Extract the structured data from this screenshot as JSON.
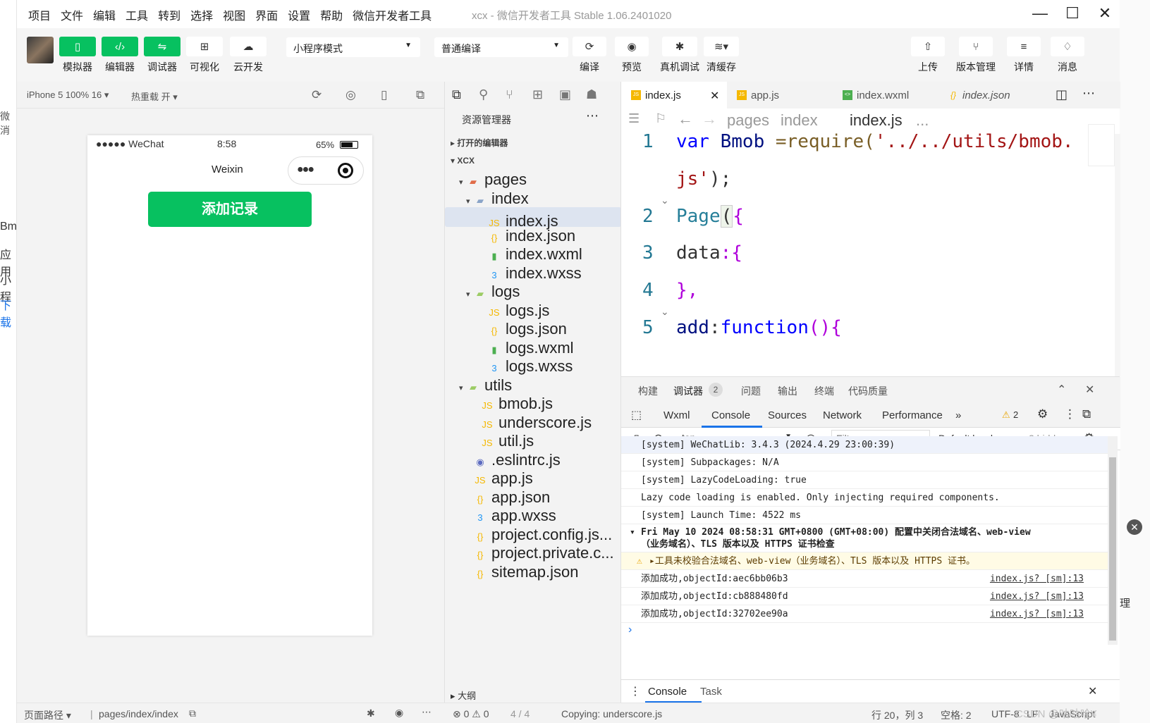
{
  "menu": [
    "项目",
    "文件",
    "编辑",
    "工具",
    "转到",
    "选择",
    "视图",
    "界面",
    "设置",
    "帮助",
    "微信开发者工具"
  ],
  "window_title": "xcx - 微信开发者工具 Stable 1.06.2401020",
  "toolbar": {
    "simulator": "模拟器",
    "editor": "编辑器",
    "debugger": "调试器",
    "visual": "可视化",
    "cloud": "云开发",
    "mode_select": "小程序模式",
    "compile_select": "普通编译",
    "compile": "编译",
    "preview": "预览",
    "real_debug": "真机调试",
    "clear_cache": "清缓存",
    "upload": "上传",
    "version": "版本管理",
    "details": "详情",
    "messages": "消息"
  },
  "sim": {
    "device": "iPhone 5 100% 16 ▾",
    "hotreload": "热重载 开 ▾",
    "carrier": "●●●●● WeChat",
    "time": "8:58",
    "battery": "65%",
    "nav_title": "Weixin",
    "add_button": "添加记录",
    "footer_path_label": "页面路径 ▾",
    "footer_path": "pages/index/index"
  },
  "explorer": {
    "title": "资源管理器",
    "open_editors": "打开的编辑器",
    "project": "XCX",
    "outline": "大纲",
    "tree": [
      "pages",
      "index",
      "index.js",
      "index.json",
      "index.wxml",
      "index.wxss",
      "logs",
      "logs.js",
      "logs.json",
      "logs.wxml",
      "logs.wxss",
      "utils",
      "bmob.js",
      "underscore.js",
      "util.js",
      ".eslintrc.js",
      "app.js",
      "app.json",
      "app.wxss",
      "project.config.js...",
      "project.private.c...",
      "sitemap.json"
    ]
  },
  "editor": {
    "tabs": [
      "index.js",
      "app.js",
      "index.wxml",
      "index.json"
    ],
    "crumb": [
      "pages",
      "index",
      "index.js",
      "..."
    ],
    "lines": [
      {
        "n": "1",
        "parts": [
          "var ",
          "Bmob ",
          "=require(",
          "'../../utils/bmob."
        ]
      },
      {
        "n": "",
        "parts": [
          "js'",
          ");"
        ]
      },
      {
        "n": "2",
        "parts": [
          "Page",
          "(",
          "{"
        ]
      },
      {
        "n": "3",
        "parts": [
          "data",
          ":{"
        ]
      },
      {
        "n": "4",
        "parts": [
          "},"
        ]
      },
      {
        "n": "5",
        "parts": [
          "add",
          ":",
          "function",
          "(){"
        ]
      }
    ]
  },
  "panel": {
    "tabs": [
      "构建",
      "调试器",
      "2",
      "问题",
      "输出",
      "终端",
      "代码质量"
    ],
    "devtabs": [
      "Wxml",
      "Console",
      "Sources",
      "Network",
      "Performance",
      "»"
    ],
    "warn_count": "2",
    "context": "top",
    "filter_placeholder": "Filter",
    "levels": "Default levels ▾",
    "hidden": "2 hidden",
    "logs": [
      {
        "text": "[system] WeChatLib: 3.4.3 (2024.4.29 23:00:39)",
        "src": ""
      },
      {
        "text": "[system] Subpackages: N/A",
        "src": ""
      },
      {
        "text": "[system] LazyCodeLoading: true",
        "src": ""
      },
      {
        "text": "Lazy code loading is enabled. Only injecting required components.",
        "src": ""
      },
      {
        "text": "[system] Launch Time: 4522 ms",
        "src": ""
      }
    ],
    "group_header_1": "Fri May 10 2024 08:58:31 GMT+0800 (GMT+08:00) 配置中关闭合法域名、web-view",
    "group_header_2": "（业务域名）、TLS 版本以及 HTTPS 证书检查",
    "warning": "▸工具未校验合法域名、web-view（业务域名）、TLS 版本以及 HTTPS 证书。",
    "results": [
      {
        "text": "添加成功,objectId:aec6bb06b3",
        "src": "index.js? [sm]:13"
      },
      {
        "text": "添加成功,objectId:cb888480fd",
        "src": "index.js? [sm]:13"
      },
      {
        "text": "添加成功,objectId:32702ee90a",
        "src": "index.js? [sm]:13"
      }
    ],
    "prompt": "›",
    "foot_tabs": [
      "Console",
      "Task"
    ]
  },
  "status": {
    "errors": "⊗ 0 ⚠ 0",
    "pos": "4 / 4",
    "copying": "Copying: underscore.js",
    "cursor": "行 20，列 3",
    "spaces": "空格: 2",
    "encoding": "UTF-8",
    "eol": "LF",
    "lang": "JavaScript"
  },
  "watermark": "CSDN @咕咕哈¥",
  "left_partial": [
    "微消",
    "Bmo",
    "应用",
    "小程",
    "下载"
  ],
  "right_partial": [
    "理"
  ]
}
